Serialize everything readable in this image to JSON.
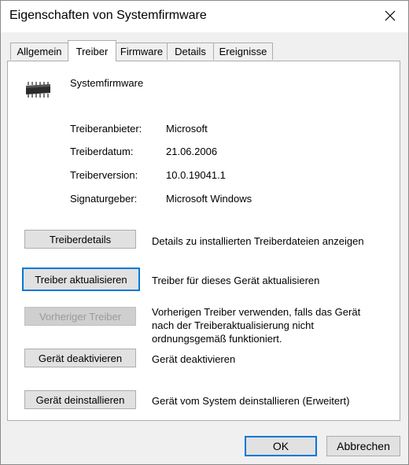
{
  "window": {
    "title": "Eigenschaften von Systemfirmware",
    "close_icon": "close-icon"
  },
  "tabs": [
    {
      "label": "Allgemein",
      "active": false
    },
    {
      "label": "Treiber",
      "active": true
    },
    {
      "label": "Firmware",
      "active": false
    },
    {
      "label": "Details",
      "active": false
    },
    {
      "label": "Ereignisse",
      "active": false
    }
  ],
  "device": {
    "icon": "chip-icon",
    "name": "Systemfirmware"
  },
  "driver_info": [
    {
      "label": "Treiberanbieter:",
      "value": "Microsoft"
    },
    {
      "label": "Treiberdatum:",
      "value": "21.06.2006"
    },
    {
      "label": "Treiberversion:",
      "value": "10.0.19041.1"
    },
    {
      "label": "Signaturgeber:",
      "value": "Microsoft Windows"
    }
  ],
  "actions": [
    {
      "label": "Treiberdetails",
      "description": "Details zu installierten Treiberdateien anzeigen",
      "enabled": true,
      "focused": false
    },
    {
      "label": "Treiber aktualisieren",
      "description": "Treiber für dieses Gerät aktualisieren",
      "enabled": true,
      "focused": true
    },
    {
      "label": "Vorheriger Treiber",
      "description_lines": [
        "Vorherigen Treiber verwenden, falls das Gerät",
        "nach der Treiberaktualisierung nicht",
        "ordnungsgemäß funktioniert."
      ],
      "enabled": false,
      "focused": false
    },
    {
      "label": "Gerät deaktivieren",
      "description": "Gerät deaktivieren",
      "enabled": true,
      "focused": false
    },
    {
      "label": "Gerät deinstallieren",
      "description": "Gerät vom System deinstallieren (Erweitert)",
      "enabled": true,
      "focused": false
    }
  ],
  "footer": {
    "ok_label": "OK",
    "cancel_label": "Abbrechen"
  },
  "colors": {
    "focus_accent": "#0078d7",
    "dialog_background": "#f0f0f0",
    "panel_background": "#ffffff"
  }
}
